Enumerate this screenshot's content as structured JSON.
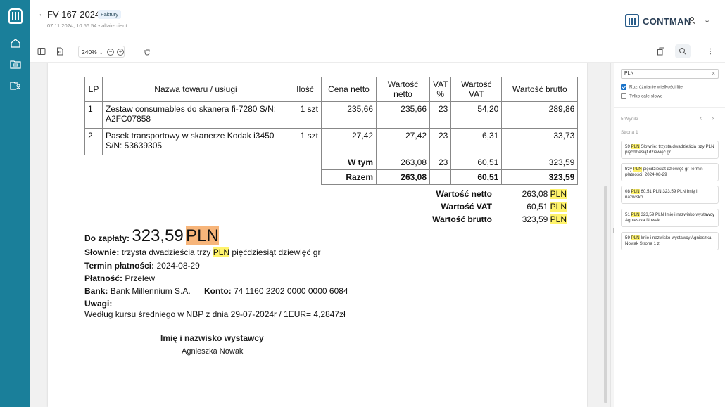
{
  "header": {
    "back_arrow": "←",
    "title": "FV-167-2024",
    "badge": "Faktury",
    "subtitle": "07.11.2024, 10:56:54 • altair-client",
    "brand": "CONTMAN",
    "chevron": "⌄"
  },
  "toolbar": {
    "zoom": "240% ⌄",
    "zoom_out": "−",
    "zoom_in": "+"
  },
  "invoice": {
    "headers": [
      "LP",
      "Nazwa towaru / usługi",
      "Ilość",
      "Cena netto",
      "Wartość netto",
      "VAT %",
      "Wartość VAT",
      "Wartość brutto"
    ],
    "rows": [
      {
        "lp": "1",
        "name": "Zestaw consumables do skanera fi-7280 S/N: A2FC07858",
        "qty": "1 szt",
        "price": "235,66",
        "net": "235,66",
        "vat_pct": "23",
        "vat": "54,20",
        "gross": "289,86"
      },
      {
        "lp": "2",
        "name": "Pasek transportowy w skanerze Kodak i3450 S/N: 53639305",
        "qty": "1 szt",
        "price": "27,42",
        "net": "27,42",
        "vat_pct": "23",
        "vat": "6,31",
        "gross": "33,73"
      }
    ],
    "wtym": {
      "label": "W tym",
      "net": "263,08",
      "vat_pct": "23",
      "vat": "60,51",
      "gross": "323,59"
    },
    "razem": {
      "label": "Razem",
      "net": "263,08",
      "vat": "60,51",
      "gross": "323,59"
    },
    "summary": [
      {
        "label": "Wartość netto",
        "value": "263,08",
        "currency": "PLN"
      },
      {
        "label": "Wartość VAT",
        "value": "60,51",
        "currency": "PLN"
      },
      {
        "label": "Wartość brutto",
        "value": "323,59",
        "currency": "PLN"
      }
    ],
    "do_zaplaty_label": "Do zapłaty:",
    "do_zaplaty_value": "323,59",
    "do_zaplaty_currency": "PLN",
    "slownie_label": "Słownie:",
    "slownie_pre": "trzysta dwadzieścia trzy",
    "slownie_hl": "PLN",
    "slownie_post": "pięćdziesiąt dziewięć gr",
    "termin_label": "Termin płatności:",
    "termin_value": "2024-08-29",
    "platnosc_label": "Płatność:",
    "platnosc_value": "Przelew",
    "bank_label": "Bank:",
    "bank_value": "Bank Millennium S.A.",
    "konto_label": "Konto:",
    "konto_value": "74 1160 2202 0000 0000 6084",
    "uwagi_label": "Uwagi:",
    "uwagi_value": "Według kursu średniego w NBP z dnia 29-07-2024r / 1EUR= 4,2847zł",
    "signature_label": "Imię i nazwisko wystawcy",
    "signature_name": "Agnieszka Nowak"
  },
  "search_panel": {
    "query": "PLN",
    "clear": "×",
    "opt_case": "Rozróżnianie wielkości liter",
    "opt_case_checked": true,
    "opt_word": "Tylko całe słowo",
    "opt_word_checked": false,
    "result_count": "5 Wyniki",
    "prev": "‹",
    "next": "›",
    "page_label": "Strona 1",
    "results": [
      {
        "pre": "59 ",
        "hl": "PLN",
        "post": " Słownie: trzysta dwadzieścia trzy PLN pięćdziesiąt dziewięć gr"
      },
      {
        "pre": "trzy ",
        "hl": "PLN",
        "post": " pięćdziesiąt dziewięć gr Termin płatności: 2024-08-29"
      },
      {
        "pre": "08 ",
        "hl": "PLN",
        "post": " 60,51 PLN 323,59 PLN Imię i nazwisko"
      },
      {
        "pre": "51 ",
        "hl": "PLN",
        "post": " 323,59 PLN Imię i nazwisko wystawcy Agnieszka Nowak"
      },
      {
        "pre": "59 ",
        "hl": "PLN",
        "post": " Imię i nazwisko wystawcy Agnieszka Nowak Strona 1 z"
      }
    ]
  },
  "grip": "||"
}
